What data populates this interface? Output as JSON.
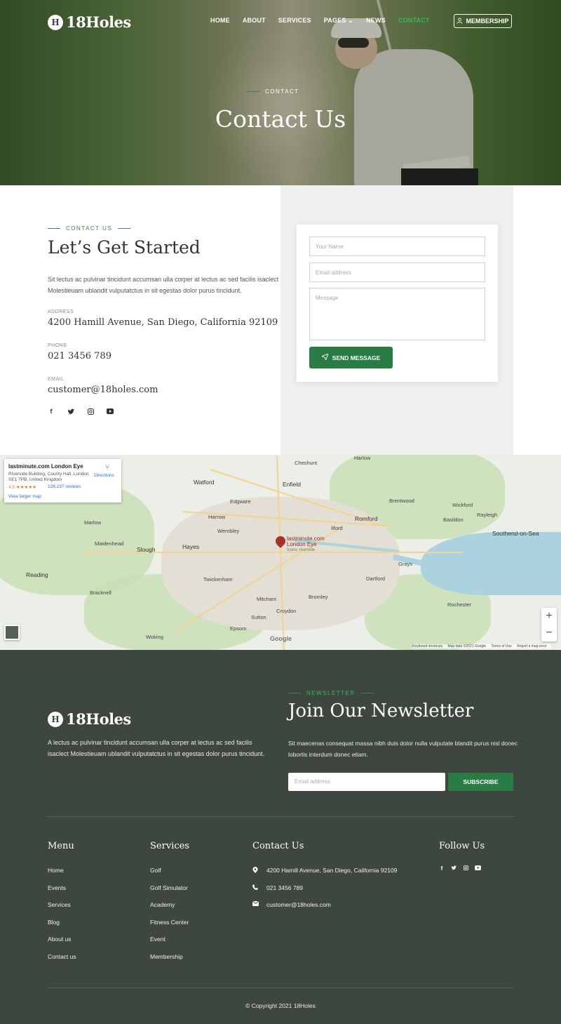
{
  "brand": {
    "name": "18Holes",
    "badge": "H"
  },
  "nav": {
    "items": [
      "HOME",
      "ABOUT",
      "SERVICES",
      "PAGES",
      "NEWS",
      "CONTACT"
    ],
    "active_index": 5,
    "membership": "MEMBERSHIP",
    "accent": "#2fbb5a"
  },
  "hero": {
    "eyebrow": "CONTACT",
    "title": "Contact Us"
  },
  "contact": {
    "eyebrow": "CONTACT US",
    "title": "Let’s Get Started",
    "intro": "Sit lectus ac pulvinar tincidunt accumsan ulla corper at lectus ac sed facilis isaclect Molestieuam ublandit vulputatctus in sit egestas dolor purus tincidunt.",
    "address_label": "ADDRESS",
    "address": "4200 Hamill Avenue, San Diego, California 92109",
    "phone_label": "PHONE",
    "phone": "021 3456 789",
    "email_label": "EMAIL",
    "email": "customer@18holes.com",
    "socials": [
      "facebook-icon",
      "twitter-icon",
      "instagram-icon",
      "youtube-icon"
    ]
  },
  "form": {
    "name_placeholder": "Your Name",
    "email_placeholder": "Email address",
    "message_placeholder": "Message",
    "send_label": "SEND MESSAGE",
    "button_color": "#2a7c45"
  },
  "map": {
    "card": {
      "title": "lastminute.com London Eye",
      "address": "Riverside Building, County Hall, London SE1 7PB, United Kingdom",
      "rating": "4.5 ★★★★★",
      "reviews": "128,237 reviews",
      "larger_map": "View larger map",
      "directions": "Directions"
    },
    "pin_label_1": "lastminute.com",
    "pin_label_2": "London Eye",
    "pin_sub": "Iconic riverside",
    "towns": {
      "watford": "Watford",
      "enfield": "Enfield",
      "edgware": "Edgware",
      "harrow": "Harrow",
      "wembley": "Wembley",
      "romford": "Romford",
      "ilford": "Ilford",
      "slough": "Slough",
      "hayes": "Hayes",
      "maidenhead": "Maidenhead",
      "reading": "Reading",
      "bracknell": "Bracknell",
      "twickenham": "Twickenham",
      "mitcham": "Mitcham",
      "croydon": "Croydon",
      "bromley": "Bromley",
      "sutton": "Sutton",
      "dartford": "Dartford",
      "grays": "Grays",
      "brentwood": "Brentwood",
      "basildon": "Basildon",
      "southend": "Southend-on-Sea",
      "cheshunt": "Cheshunt",
      "epsom": "Epsom",
      "woking": "Woking",
      "rochester": "Rochester",
      "harlow": "Harlow",
      "wickford": "Wickford",
      "rayleigh": "Rayleigh",
      "marlow": "Marlow"
    },
    "google": "Google",
    "footer_items": [
      "Keyboard shortcuts",
      "Map data ©2021 Google",
      "Terms of Use",
      "Report a map error"
    ],
    "zoom_in": "+",
    "zoom_out": "−"
  },
  "footer": {
    "about": "A lectus ac pulvinar tincidunt accumsan ulla corper at lectus ac sed facilis isaclect Molestieuam ublandit vulputatctus in sit egestas dolor purus tincidunt.",
    "newsletter_eyebrow": "NEWSLETTER",
    "newsletter_title": "Join Our Newsletter",
    "newsletter_text": "Sit maecenas consequat massa nibh duis dolor nulla vulputate blandit purus nisl donec lobortis interdum donec etiam.",
    "newsletter_placeholder": "Email address",
    "subscribe": "SUBSCRIBE",
    "menu_title": "Menu",
    "menu": [
      "Home",
      "Events",
      "Services",
      "Blog",
      "About us",
      "Contact us"
    ],
    "services_title": "Services",
    "services": [
      "Golf",
      "Golf Simulator",
      "Academy",
      "Fitness Center",
      "Event",
      "Membership"
    ],
    "contact_title": "Contact Us",
    "contact_address": "4200 Hamill Avenue, San Diego, California 92109",
    "contact_phone": "021 3456 789",
    "contact_email": "customer@18holes.com",
    "follow_title": "Follow Us",
    "copyright": "© Copyright 2021 18Holes",
    "background": "#3e4640"
  }
}
